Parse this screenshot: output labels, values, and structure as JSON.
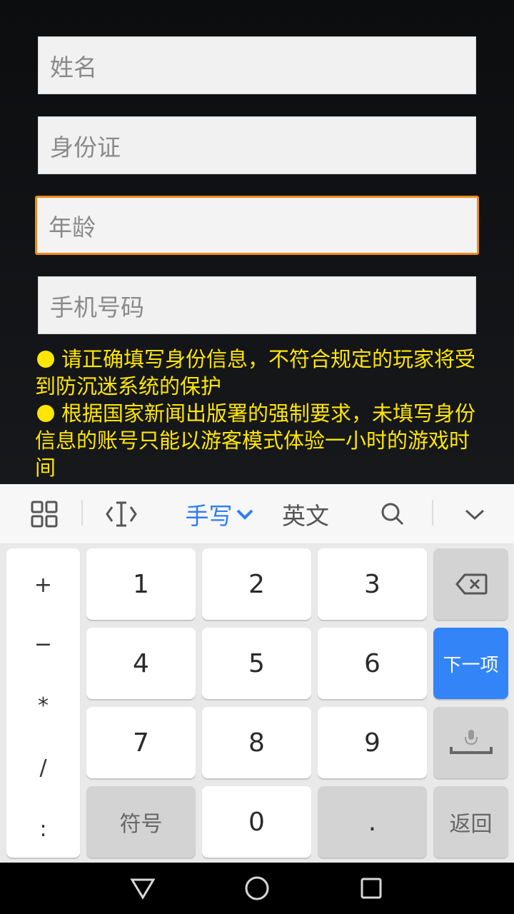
{
  "form": {
    "name_placeholder": "姓名",
    "id_placeholder": "身份证",
    "age_placeholder": "年龄",
    "phone_placeholder": "手机号码"
  },
  "notice": {
    "line1": "请正确填写身份信息，不符合规定的玩家将受到防沉迷系统的保护",
    "line2": "根据国家新闻出版署的强制要求，未填写身份信息的账号只能以游客模式体验一小时的游戏时间"
  },
  "keyboard_toolbar": {
    "menu_icon": "grid-icon",
    "cursor_icon": "text-cursor-icon",
    "handwriting_label": "手写",
    "english_label": "英文",
    "search_icon": "search-icon",
    "collapse_icon": "chevron-down-icon"
  },
  "keyboard": {
    "symbols": [
      "+",
      "−",
      "*",
      "/",
      ":"
    ],
    "digits": [
      "1",
      "2",
      "3",
      "4",
      "5",
      "6",
      "7",
      "8",
      "9",
      "0"
    ],
    "symbol_key": "符号",
    "dot_key": ".",
    "next_key": "下一项",
    "back_key": "返回",
    "accent_color": "#3384f7"
  },
  "focus_color": "#f08a1c",
  "notice_color": "#ffe600",
  "navbar": {
    "back_icon": "triangle-back-icon",
    "home_icon": "circle-home-icon",
    "recents_icon": "square-recents-icon"
  }
}
